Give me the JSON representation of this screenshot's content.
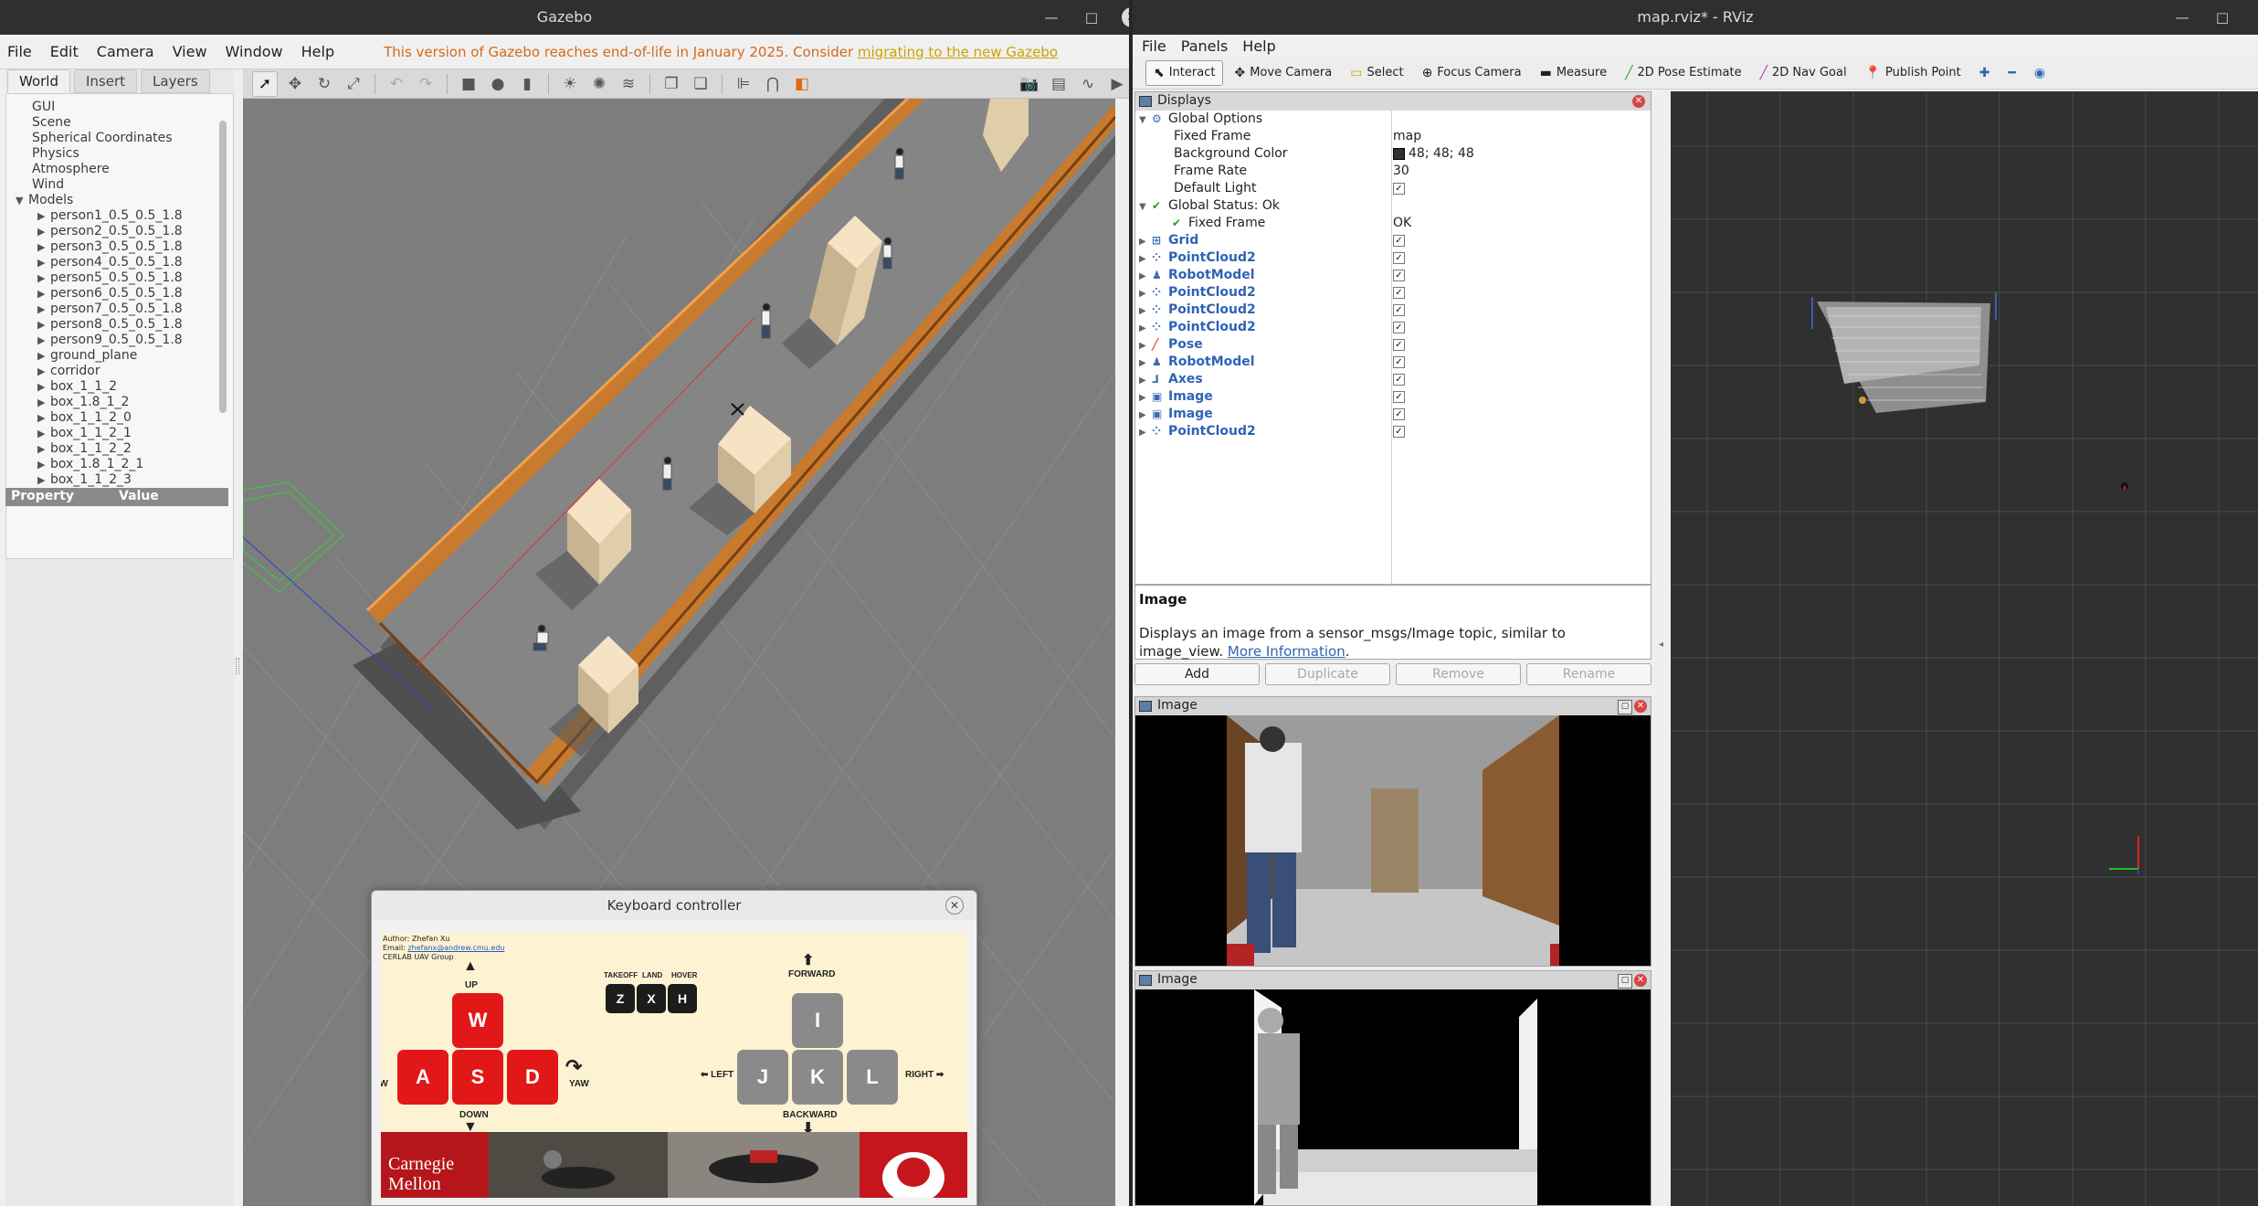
{
  "gazebo": {
    "title": "Gazebo",
    "menu": [
      "File",
      "Edit",
      "Camera",
      "View",
      "Window",
      "Help"
    ],
    "warning_text": "This version of Gazebo reaches end-of-life in January 2025. Consider ",
    "warning_link": "migrating to the new Gazebo",
    "tabs": [
      "World",
      "Insert",
      "Layers"
    ],
    "tree_top": [
      "GUI",
      "Scene",
      "Spherical Coordinates",
      "Physics",
      "Atmosphere",
      "Wind"
    ],
    "models_label": "Models",
    "models": [
      "person1_0.5_0.5_1.8",
      "person2_0.5_0.5_1.8",
      "person3_0.5_0.5_1.8",
      "person4_0.5_0.5_1.8",
      "person5_0.5_0.5_1.8",
      "person6_0.5_0.5_1.8",
      "person7_0.5_0.5_1.8",
      "person8_0.5_0.5_1.8",
      "person9_0.5_0.5_1.8",
      "ground_plane",
      "corridor",
      "box_1_1_2",
      "box_1.8_1_2",
      "box_1_1_2_0",
      "box_1_1_2_1",
      "box_1_1_2_2",
      "box_1.8_1_2_1",
      "box_1_1_2_3"
    ],
    "property_header": "Property",
    "value_header": "Value"
  },
  "keyboard": {
    "title": "Keyboard controller",
    "author": "Author: Zhefan Xu",
    "email_label": "Email: ",
    "email": "zhefanx@andrew.cmu.edu",
    "group": "CERLAB UAV Group",
    "up": "UP",
    "down": "DOWN",
    "yaw": "YAW",
    "takeoff": "TAKEOFF",
    "land": "LAND",
    "hover": "HOVER",
    "forward": "FORWARD",
    "backward": "BACKWARD",
    "left": "LEFT",
    "right": "RIGHT",
    "keys_wasd": [
      "W",
      "A",
      "S",
      "D"
    ],
    "keys_zxh": [
      "Z",
      "X",
      "H"
    ],
    "keys_ijkl": [
      "I",
      "J",
      "K",
      "L"
    ],
    "banner_text": "Carnegie Mellon"
  },
  "rviz": {
    "title": "map.rviz* - RViz",
    "menu": [
      "File",
      "Panels",
      "Help"
    ],
    "tools": [
      "Interact",
      "Move Camera",
      "Select",
      "Focus Camera",
      "Measure",
      "2D Pose Estimate",
      "2D Nav Goal",
      "Publish Point"
    ],
    "displays_title": "Displays",
    "global_options": "Global Options",
    "options": [
      {
        "label": "Fixed Frame",
        "value": "map"
      },
      {
        "label": "Background Color",
        "value": "48; 48; 48"
      },
      {
        "label": "Frame Rate",
        "value": "30"
      },
      {
        "label": "Default Light",
        "value": "✓"
      }
    ],
    "global_status": "Global Status: Ok",
    "fixed_frame_status": {
      "label": "Fixed Frame",
      "value": "OK"
    },
    "displays": [
      "Grid",
      "PointCloud2",
      "RobotModel",
      "PointCloud2",
      "PointCloud2",
      "PointCloud2",
      "Pose",
      "RobotModel",
      "Axes",
      "Image",
      "Image",
      "PointCloud2"
    ],
    "desc_title": "Image",
    "desc_text": "Displays an image from a sensor_msgs/Image topic, similar to image_view. ",
    "desc_link": "More Information",
    "buttons": [
      "Add",
      "Duplicate",
      "Remove",
      "Rename"
    ],
    "image_panel_1": "Image",
    "image_panel_2": "Image"
  },
  "colors": {
    "gazebo_warning": "#d4691a",
    "rviz_background": "#303030",
    "key_red": "#e21818",
    "key_gray": "#8a8a8a"
  }
}
